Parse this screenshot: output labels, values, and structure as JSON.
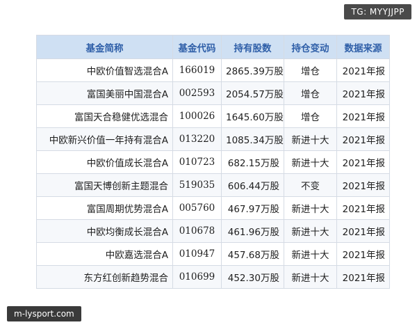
{
  "watermarks": {
    "tg": "TG: MYYJJPP",
    "site": "m-lysport.com"
  },
  "table": {
    "headers": [
      "基金简称",
      "基金代码",
      "持有股数",
      "持仓变动",
      "数据来源"
    ],
    "rows": [
      {
        "name": "中欧价值智选混合A",
        "code": "166019",
        "shares": "2865.39万股",
        "change": "增仓",
        "source": "2021年报"
      },
      {
        "name": "富国美丽中国混合A",
        "code": "002593",
        "shares": "2054.57万股",
        "change": "增仓",
        "source": "2021年报"
      },
      {
        "name": "富国天合稳健优选混合",
        "code": "100026",
        "shares": "1645.60万股",
        "change": "增仓",
        "source": "2021年报"
      },
      {
        "name": "中欧新兴价值一年持有混合A",
        "code": "013220",
        "shares": "1085.34万股",
        "change": "新进十大",
        "source": "2021年报"
      },
      {
        "name": "中欧价值成长混合A",
        "code": "010723",
        "shares": "682.15万股",
        "change": "新进十大",
        "source": "2021年报"
      },
      {
        "name": "富国天博创新主题混合",
        "code": "519035",
        "shares": "606.44万股",
        "change": "不变",
        "source": "2021年报"
      },
      {
        "name": "富国周期优势混合A",
        "code": "005760",
        "shares": "467.97万股",
        "change": "新进十大",
        "source": "2021年报"
      },
      {
        "name": "中欧均衡成长混合A",
        "code": "010678",
        "shares": "461.96万股",
        "change": "新进十大",
        "source": "2021年报"
      },
      {
        "name": "中欧嘉选混合A",
        "code": "010947",
        "shares": "457.68万股",
        "change": "新进十大",
        "source": "2021年报"
      },
      {
        "name": "东方红创新趋势混合",
        "code": "010699",
        "shares": "452.30万股",
        "change": "新进十大",
        "source": "2021年报"
      }
    ]
  },
  "colors": {
    "header_bg": "#cfe0f3",
    "header_text": "#2f5fa8",
    "border": "#d5dbe4"
  }
}
